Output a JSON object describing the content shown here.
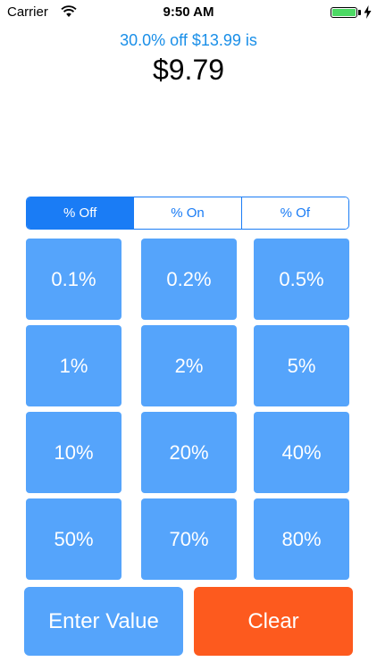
{
  "status_bar": {
    "carrier": "Carrier",
    "time": "9:50 AM"
  },
  "result": {
    "summary": "30.0% off $13.99 is",
    "value": "$9.79"
  },
  "modes": [
    "% Off",
    "% On",
    "% Of"
  ],
  "selected_mode": "% Off",
  "percent_buttons": [
    "0.1%",
    "0.2%",
    "0.5%",
    "1%",
    "2%",
    "5%",
    "10%",
    "20%",
    "40%",
    "50%",
    "70%",
    "80%"
  ],
  "actions": {
    "enter_value": "Enter Value",
    "clear": "Clear"
  },
  "colors": {
    "accent": "#1a7cf5",
    "button": "#55a4fb",
    "clear": "#fd5a1e",
    "summary_text": "#1a8fe8",
    "battery": "#4cd964"
  }
}
